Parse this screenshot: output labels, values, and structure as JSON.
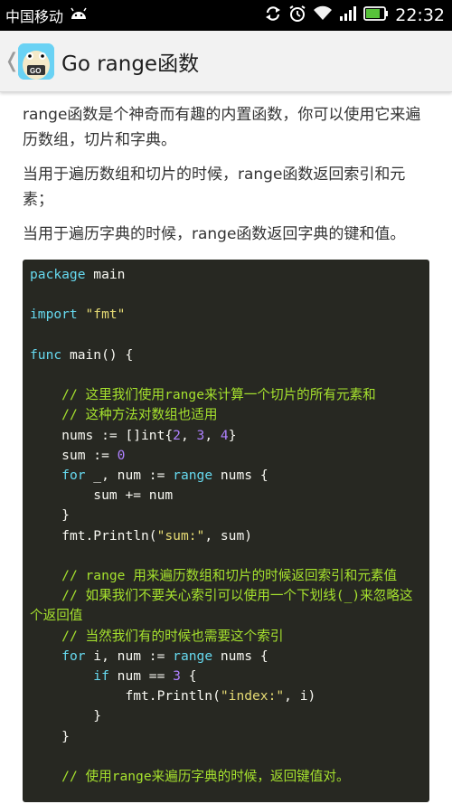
{
  "status_bar": {
    "carrier": "中国移动",
    "time": "22:32"
  },
  "action_bar": {
    "back_glyph": "❬",
    "title": "Go range函数",
    "app_icon_label": "GO"
  },
  "paragraphs": [
    "range函数是个神奇而有趣的内置函数，你可以使用它来遍历数组，切片和字典。",
    "当用于遍历数组和切片的时候，range函数返回索引和元素；",
    "当用于遍历字典的时候，range函数返回字典的键和值。"
  ],
  "code_lines": [
    [
      {
        "t": "package",
        "c": "kw"
      },
      {
        "t": " main",
        "c": "pl"
      }
    ],
    [],
    [
      {
        "t": "import",
        "c": "kw"
      },
      {
        "t": " ",
        "c": "pl"
      },
      {
        "t": "\"fmt\"",
        "c": "str"
      }
    ],
    [],
    [
      {
        "t": "func",
        "c": "kw"
      },
      {
        "t": " main() {",
        "c": "pl"
      }
    ],
    [],
    [
      {
        "t": "    ",
        "c": "pl"
      },
      {
        "t": "// 这里我们使用range来计算一个切片的所有元素和",
        "c": "cm"
      }
    ],
    [
      {
        "t": "    ",
        "c": "pl"
      },
      {
        "t": "// 这种方法对数组也适用",
        "c": "cm"
      }
    ],
    [
      {
        "t": "    nums := []int{",
        "c": "pl"
      },
      {
        "t": "2",
        "c": "num"
      },
      {
        "t": ", ",
        "c": "pl"
      },
      {
        "t": "3",
        "c": "num"
      },
      {
        "t": ", ",
        "c": "pl"
      },
      {
        "t": "4",
        "c": "num"
      },
      {
        "t": "}",
        "c": "pl"
      }
    ],
    [
      {
        "t": "    sum := ",
        "c": "pl"
      },
      {
        "t": "0",
        "c": "num"
      }
    ],
    [
      {
        "t": "    ",
        "c": "pl"
      },
      {
        "t": "for",
        "c": "kw"
      },
      {
        "t": " _, num := ",
        "c": "pl"
      },
      {
        "t": "range",
        "c": "kw"
      },
      {
        "t": " nums {",
        "c": "pl"
      }
    ],
    [
      {
        "t": "        sum += num",
        "c": "pl"
      }
    ],
    [
      {
        "t": "    }",
        "c": "pl"
      }
    ],
    [
      {
        "t": "    fmt.Println(",
        "c": "pl"
      },
      {
        "t": "\"sum:\"",
        "c": "str"
      },
      {
        "t": ", sum)",
        "c": "pl"
      }
    ],
    [],
    [
      {
        "t": "    ",
        "c": "pl"
      },
      {
        "t": "// range 用来遍历数组和切片的时候返回索引和元素值",
        "c": "cm"
      }
    ],
    [
      {
        "t": "    ",
        "c": "pl"
      },
      {
        "t": "// 如果我们不要关心索引可以使用一个下划线(_)来忽略这个返回值",
        "c": "cm"
      }
    ],
    [
      {
        "t": "    ",
        "c": "pl"
      },
      {
        "t": "// 当然我们有的时候也需要这个索引",
        "c": "cm"
      }
    ],
    [
      {
        "t": "    ",
        "c": "pl"
      },
      {
        "t": "for",
        "c": "kw"
      },
      {
        "t": " i, num := ",
        "c": "pl"
      },
      {
        "t": "range",
        "c": "kw"
      },
      {
        "t": " nums {",
        "c": "pl"
      }
    ],
    [
      {
        "t": "        ",
        "c": "pl"
      },
      {
        "t": "if",
        "c": "kw"
      },
      {
        "t": " num == ",
        "c": "pl"
      },
      {
        "t": "3",
        "c": "num"
      },
      {
        "t": " {",
        "c": "pl"
      }
    ],
    [
      {
        "t": "            fmt.Println(",
        "c": "pl"
      },
      {
        "t": "\"index:\"",
        "c": "str"
      },
      {
        "t": ", i)",
        "c": "pl"
      }
    ],
    [
      {
        "t": "        }",
        "c": "pl"
      }
    ],
    [
      {
        "t": "    }",
        "c": "pl"
      }
    ],
    [],
    [
      {
        "t": "    ",
        "c": "pl"
      },
      {
        "t": "// 使用range来遍历字典的时候，返回键值对。",
        "c": "cm"
      }
    ]
  ],
  "colors": {
    "code_background": "#272822",
    "keyword": "#66d9ef",
    "string": "#e6db74",
    "number": "#ae81ff",
    "comment": "#a6e22e"
  }
}
